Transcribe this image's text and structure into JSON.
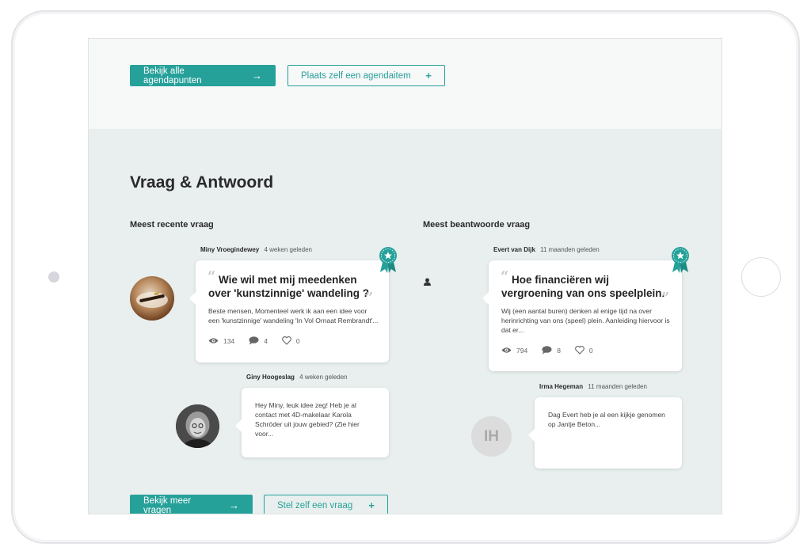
{
  "agenda": {
    "view_all_label": "Bekijk alle agendapunten",
    "place_label": "Plaats zelf een agendaitem"
  },
  "qa": {
    "title": "Vraag & Antwoord",
    "recent": {
      "heading": "Meest recente vraag",
      "question": {
        "author": "Miny Vroegindewey",
        "time": "4 weken geleden",
        "title_line1": "Wie wil met mij meedenken",
        "title_line2": "over 'kunstzinnige' wandeling ?",
        "body_line1": "Beste mensen, Momenteel werk ik aan een idee voor",
        "body_line2": "een 'kunstzinnige' wandeling 'In Vol Ornaat Rembrandt'...",
        "views": "134",
        "comments": "4",
        "likes": "0"
      },
      "reply": {
        "author": "Giny Hoogeslag",
        "time": "4 weken geleden",
        "body_line1": "Hey Miny, leuk idee zeg! Heb je al",
        "body_line2": "contact met 4D-makelaar Karola",
        "body_line3": "Schröder uit jouw gebied? (Zie hier",
        "body_line4": "voor..."
      }
    },
    "answered": {
      "heading": "Meest beantwoorde vraag",
      "question": {
        "author": "Evert van Dijk",
        "time": "11 maanden geleden",
        "title_line1": "Hoe financiëren wij",
        "title_line2": "vergroening van ons speelplein.",
        "body_line1": "Wij (een aantal buren) denken al enige tijd na over",
        "body_line2": "herinrichting van ons (speel) plein. Aanleiding hiervoor is",
        "body_line3": "dat er...",
        "views": "794",
        "comments": "8",
        "likes": "0"
      },
      "reply": {
        "author": "Irma Hegeman",
        "time": "11 maanden geleden",
        "initials": "IH",
        "body_line1": "Dag Evert   heb je al een kijkje genomen",
        "body_line2": "op Jantje Beton..."
      }
    },
    "more_label": "Bekijk meer vragen",
    "ask_label": "Stel zelf een vraag"
  },
  "colors": {
    "accent": "#26a19a",
    "qa_background": "#e8efee"
  },
  "icons": {
    "arrow": "→",
    "plus": "+"
  }
}
